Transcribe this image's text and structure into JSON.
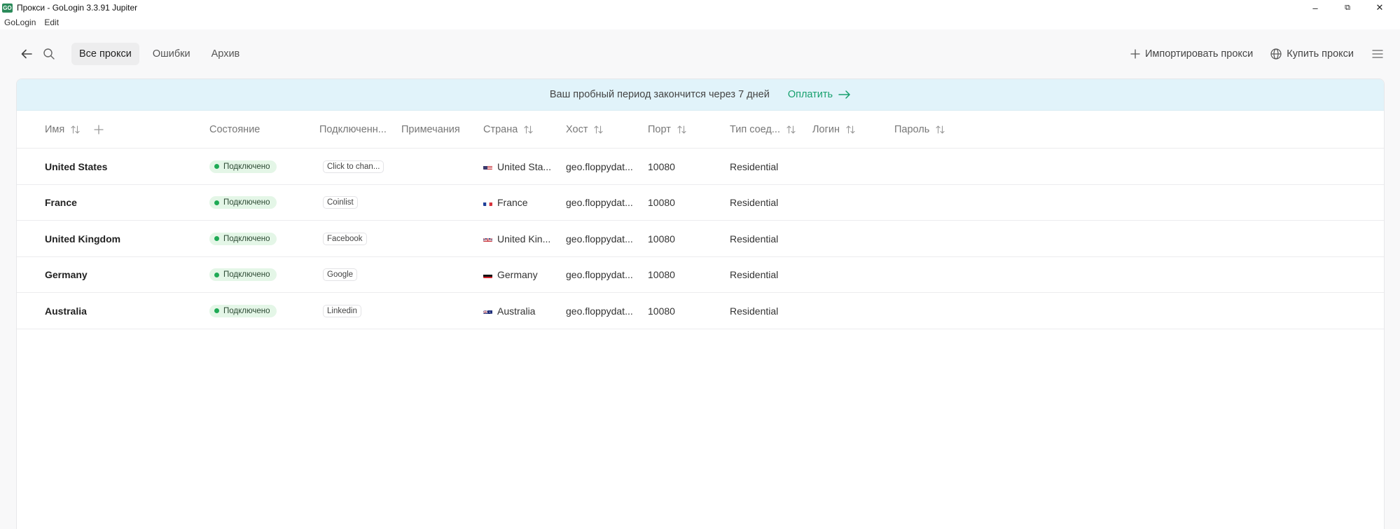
{
  "window": {
    "logo_text": "GO",
    "title": "Прокси - GoLogin 3.3.91 Jupiter",
    "minimize": "–",
    "restore": "⧉",
    "close": "✕"
  },
  "menubar": [
    "GoLogin",
    "Edit"
  ],
  "toolbar": {
    "tabs": [
      "Все прокси",
      "Ошибки",
      "Архив"
    ],
    "import_label": "Импортировать прокси",
    "buy_label": "Купить прокси"
  },
  "banner": {
    "text": "Ваш пробный период закончится через 7 дней",
    "pay_label": "Оплатить"
  },
  "columns": {
    "name": "Имя",
    "status": "Состояние",
    "connected": "Подключенн...",
    "notes": "Примечания",
    "country": "Страна",
    "host": "Хост",
    "port": "Порт",
    "type": "Тип соед...",
    "login": "Логин",
    "password": "Пароль"
  },
  "rows": [
    {
      "name": "United States",
      "status": "Подключено",
      "connected": "Click to chan...",
      "country": "United Sta...",
      "flag": "us",
      "host": "geo.floppydat...",
      "port": "10080",
      "type": "Residential"
    },
    {
      "name": "France",
      "status": "Подключено",
      "connected": "Coinlist",
      "country": "France",
      "flag": "fr",
      "host": "geo.floppydat...",
      "port": "10080",
      "type": "Residential"
    },
    {
      "name": "United Kingdom",
      "status": "Подключено",
      "connected": "Facebook",
      "country": "United Kin...",
      "flag": "gb",
      "host": "geo.floppydat...",
      "port": "10080",
      "type": "Residential"
    },
    {
      "name": "Germany",
      "status": "Подключено",
      "connected": "Google",
      "country": "Germany",
      "flag": "de",
      "host": "geo.floppydat...",
      "port": "10080",
      "type": "Residential"
    },
    {
      "name": "Australia",
      "status": "Подключено",
      "connected": "Linkedin",
      "country": "Australia",
      "flag": "au",
      "host": "geo.floppydat...",
      "port": "10080",
      "type": "Residential"
    }
  ],
  "colors": {
    "accent": "#17a06e",
    "banner_bg": "#e1f3fa",
    "status_dot": "#1faa55",
    "status_bg": "#e4f6e7"
  }
}
